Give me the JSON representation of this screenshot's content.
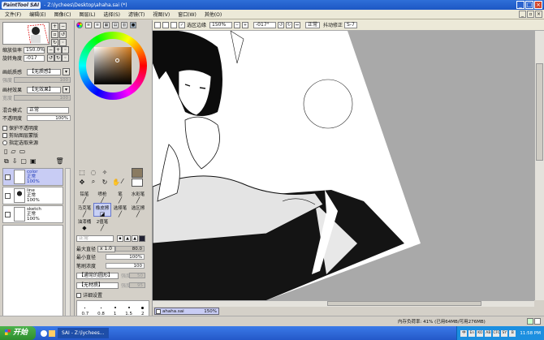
{
  "window": {
    "app_name": "PaintTool SAI",
    "title_text": "- Z:\\lychees\\Desktop\\ahaha.sai (*)"
  },
  "menu": [
    "文件(F)",
    "编辑(E)",
    "图像(C)",
    "图层(L)",
    "选择(S)",
    "滤镜(T)",
    "视图(V)",
    "窗口(W)",
    "其他(O)"
  ],
  "navigator": {
    "zoom_label": "缩放倍率",
    "zoom_value": "150.0%",
    "angle_label": "旋转角度",
    "angle_value": "-017"
  },
  "paper": {
    "texture_label": "画纸质感",
    "texture_value": "【无质感】",
    "texture_strength": "强度",
    "texture_amount": "100",
    "effect_label": "画材效果",
    "effect_value": "【无效果】",
    "effect_width": "宽度",
    "effect_amount": "100"
  },
  "layer_props": {
    "blend_label": "混合模式",
    "blend_value": "正常",
    "opacity_label": "不透明度",
    "opacity_value": "100%",
    "opacity_level": 1.0,
    "options": [
      "保护不透明度",
      "剪贴图层蒙版",
      "指定选取来源"
    ]
  },
  "layers": [
    {
      "name": "color",
      "mode": "正常",
      "opacity": "100%",
      "selected": true
    },
    {
      "name": "line",
      "mode": "正常",
      "opacity": "100%",
      "selected": false
    },
    {
      "name": "sketch",
      "mode": "正常",
      "opacity": "100%",
      "selected": false
    }
  ],
  "brush_tools": [
    {
      "label": "铅笔",
      "icon": "pencil-icon"
    },
    {
      "label": "喷枪",
      "icon": "airbrush-icon"
    },
    {
      "label": "笔",
      "icon": "brush-icon"
    },
    {
      "label": "水彩笔",
      "icon": "watercolor-icon"
    },
    {
      "label": "马克笔",
      "icon": "marker-icon"
    },
    {
      "label": "橡皮擦",
      "icon": "eraser-icon"
    },
    {
      "label": "选择笔",
      "icon": "selpen-icon"
    },
    {
      "label": "选区擦",
      "icon": "selerase-icon"
    },
    {
      "label": "油漆桶",
      "icon": "bucket-icon"
    },
    {
      "label": "2值笔",
      "icon": "binary-pen-icon"
    }
  ],
  "brush_settings": {
    "mode": "正常",
    "max_size_label": "最大直径",
    "max_size_mult": "x 1.0",
    "max_size_value": "80.0",
    "min_size_label": "最小直径",
    "min_size_value": "100%",
    "min_size_level": 1.0,
    "density_label": "笔刷浓度",
    "density_value": "100",
    "density_level": 1.0,
    "shape_value": "【通常的圆形】",
    "shape_strength": "强度",
    "shape_amount": "50",
    "texture_value": "【无材质】",
    "texture_strength": "强度",
    "texture_amount": "95",
    "detail_label": "详细设置",
    "size_presets": [
      "0.7",
      "0.8",
      "1",
      "1.5",
      "2"
    ]
  },
  "canvas_toolbar": {
    "select_label": "选区边缘",
    "zoom_value": "150%",
    "angle_value": "-017°",
    "mode_value": "正常",
    "stabilizer_label": "抖动修正",
    "stabilizer_value": "S-7"
  },
  "document_tab": {
    "name": "ahaha.sai",
    "zoom": "150%"
  },
  "status": {
    "text": "内存负荷率: 41% (已用64MB/可用276MB)"
  },
  "taskbar": {
    "start_label": "开始",
    "tasks": [
      "SAI - Z:\\lychees..."
    ],
    "tray_icons": [
      "中",
      "En",
      "KO",
      "AB",
      "CFC",
      "SY",
      "B"
    ],
    "clock": "11:58 PM"
  },
  "colors": {
    "primary": "#8a7b62",
    "accent": "#2a5ec9",
    "selected_layer": "#c8ccf4"
  }
}
